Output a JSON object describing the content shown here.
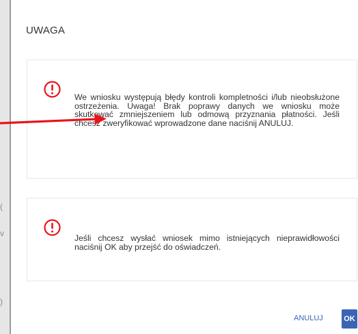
{
  "dialog": {
    "title": "UWAGA",
    "messages": [
      {
        "icon": "warning-circle-icon",
        "text": "We wniosku występują błędy kontroli kompletności i/lub nieobsłużone ostrzeżenia. Uwaga! Brak poprawy danych we wniosku może skutkować zmniejszeniem lub odmową przyznania płatności. Jeśli chcesz zweryfikować wprowadzone dane naciśnij ANULUJ."
      },
      {
        "icon": "warning-circle-icon",
        "text": "Jeśli chcesz wysłać wniosek mimo istniejących nieprawidłowości naciśnij OK aby przejść do oświadczeń."
      }
    ],
    "buttons": {
      "cancel_label": "ANULUJ",
      "ok_label": "OK"
    }
  },
  "backdrop": {
    "glyphs": [
      "(",
      "v",
      ")"
    ]
  },
  "colors": {
    "warning": "#e8141b",
    "arrow": "#e8141b",
    "primary": "#3b64b5",
    "text": "#333333"
  }
}
